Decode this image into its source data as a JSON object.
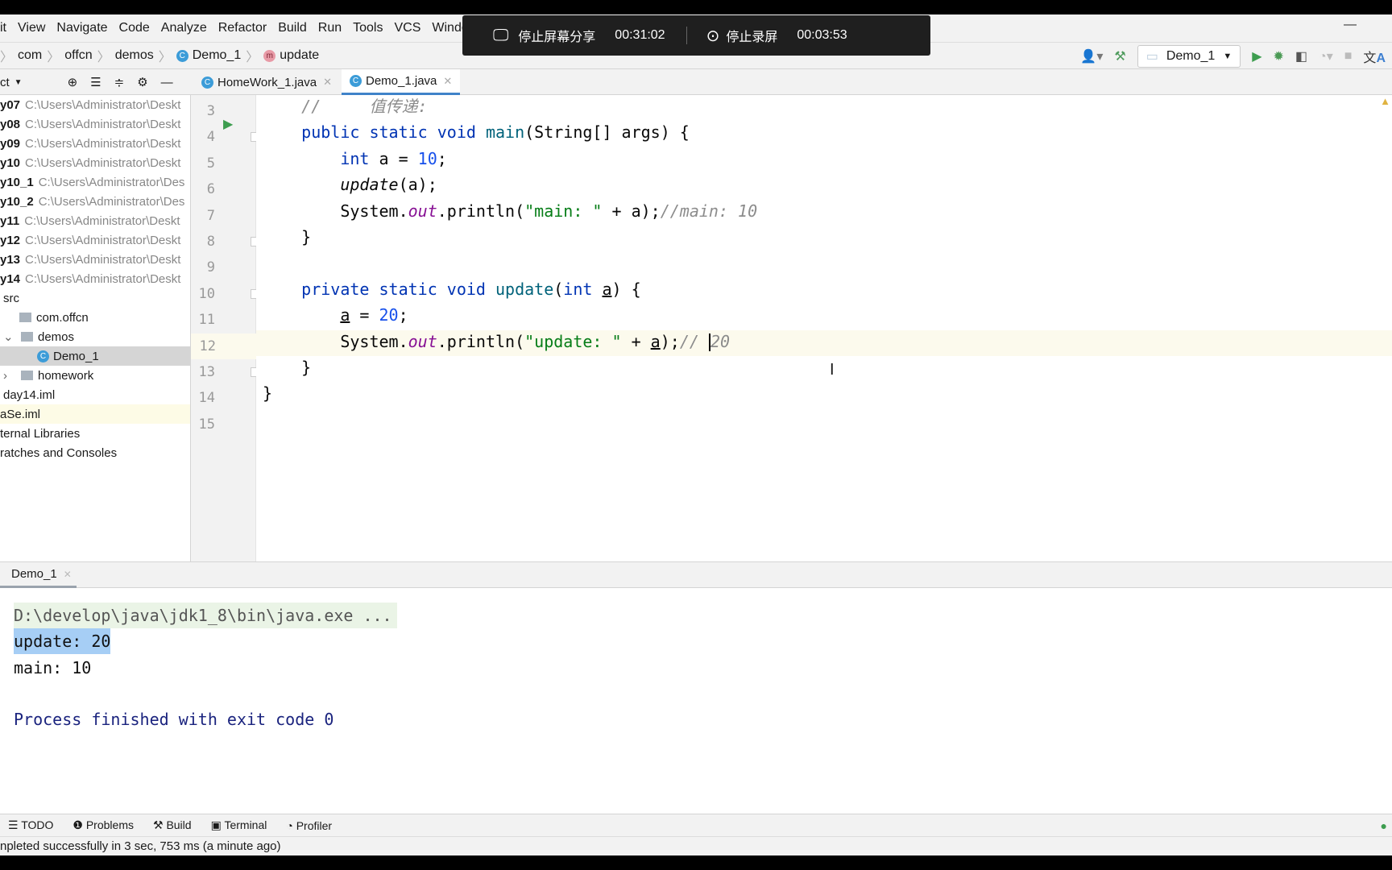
{
  "menu": [
    "it",
    "View",
    "Navigate",
    "Code",
    "Analyze",
    "Refactor",
    "Build",
    "Run",
    "Tools",
    "VCS",
    "Windo"
  ],
  "breadcrumb": [
    "com",
    "offcn",
    "demos",
    "Demo_1",
    "update"
  ],
  "toolbar": {
    "run_config": "Demo_1"
  },
  "project_header": "ct",
  "tabs": [
    {
      "label": "HomeWork_1.java"
    },
    {
      "label": "Demo_1.java"
    }
  ],
  "tree": [
    {
      "name": "y07",
      "path": "C:\\Users\\Administrator\\Deskt"
    },
    {
      "name": "y08",
      "path": "C:\\Users\\Administrator\\Deskt"
    },
    {
      "name": "y09",
      "path": "C:\\Users\\Administrator\\Deskt"
    },
    {
      "name": "y10",
      "path": "C:\\Users\\Administrator\\Deskt"
    },
    {
      "name": "y10_1",
      "path": "C:\\Users\\Administrator\\Des"
    },
    {
      "name": "y10_2",
      "path": "C:\\Users\\Administrator\\Des"
    },
    {
      "name": "y11",
      "path": "C:\\Users\\Administrator\\Deskt"
    },
    {
      "name": "y12",
      "path": "C:\\Users\\Administrator\\Deskt"
    },
    {
      "name": "y13",
      "path": "C:\\Users\\Administrator\\Deskt"
    },
    {
      "name": "y14",
      "path": "C:\\Users\\Administrator\\Deskt"
    }
  ],
  "tree_more": [
    "src",
    "com.offcn",
    "demos",
    "Demo_1",
    "homework",
    "day14.iml",
    "aSe.iml",
    "ternal Libraries",
    "ratches and Consoles"
  ],
  "line_numbers": [
    "3",
    "4",
    "5",
    "6",
    "7",
    "8",
    "9",
    "10",
    "11",
    "12",
    "13",
    "14",
    "15"
  ],
  "code": [
    [
      {
        "t": "    ",
        "c": ""
      },
      {
        "t": "//     值传递:",
        "c": "cm"
      }
    ],
    [
      {
        "t": "    ",
        "c": ""
      },
      {
        "t": "public static void ",
        "c": "kw"
      },
      {
        "t": "main",
        "c": "mth"
      },
      {
        "t": "(String[] args) {",
        "c": ""
      }
    ],
    [
      {
        "t": "        ",
        "c": ""
      },
      {
        "t": "int",
        "c": "kw"
      },
      {
        "t": " a = ",
        "c": ""
      },
      {
        "t": "10",
        "c": "num"
      },
      {
        "t": ";",
        "c": ""
      }
    ],
    [
      {
        "t": "        ",
        "c": ""
      },
      {
        "t": "update",
        "c": "it"
      },
      {
        "t": "(a);",
        "c": ""
      }
    ],
    [
      {
        "t": "        System.",
        "c": ""
      },
      {
        "t": "out",
        "c": "fld"
      },
      {
        "t": ".println(",
        "c": ""
      },
      {
        "t": "\"main: \"",
        "c": "str"
      },
      {
        "t": " + a);",
        "c": ""
      },
      {
        "t": "//main: 10",
        "c": "cm"
      }
    ],
    [
      {
        "t": "    }",
        "c": ""
      }
    ],
    [
      {
        "t": "",
        "c": ""
      }
    ],
    [
      {
        "t": "    ",
        "c": ""
      },
      {
        "t": "private static void ",
        "c": "kw"
      },
      {
        "t": "update",
        "c": "mth"
      },
      {
        "t": "(",
        "c": ""
      },
      {
        "t": "int ",
        "c": "kw"
      },
      {
        "t": "a",
        "c": "ul"
      },
      {
        "t": ") {",
        "c": ""
      }
    ],
    [
      {
        "t": "        ",
        "c": ""
      },
      {
        "t": "a",
        "c": "ul"
      },
      {
        "t": " = ",
        "c": ""
      },
      {
        "t": "20",
        "c": "num"
      },
      {
        "t": ";",
        "c": ""
      }
    ],
    [
      {
        "t": "        System.",
        "c": ""
      },
      {
        "t": "out",
        "c": "fld"
      },
      {
        "t": ".println(",
        "c": ""
      },
      {
        "t": "\"update: \"",
        "c": "str"
      },
      {
        "t": " + ",
        "c": ""
      },
      {
        "t": "a",
        "c": "ul"
      },
      {
        "t": ");",
        "c": ""
      },
      {
        "t": "// ",
        "c": "cm"
      },
      {
        "t": "|",
        "c": "caret"
      },
      {
        "t": "20",
        "c": "cm"
      }
    ],
    [
      {
        "t": "    }",
        "c": ""
      }
    ],
    [
      {
        "t": "}",
        "c": ""
      }
    ],
    [
      {
        "t": "",
        "c": ""
      }
    ]
  ],
  "run_tab": "Demo_1",
  "console": {
    "cmd": "D:\\develop\\java\\jdk1_8\\bin\\java.exe ...",
    "out1": "update: 20",
    "out2": "main: 10",
    "exit": "Process finished with exit code 0"
  },
  "tool_windows": [
    "TODO",
    "Problems",
    "Build",
    "Terminal",
    "Profiler"
  ],
  "status": "npleted successfully in 3 sec, 753 ms (a minute ago)",
  "recording": {
    "stop_share": "停止屏幕分享",
    "share_time": "00:31:02",
    "stop_record": "停止录屏",
    "record_time": "00:03:53"
  }
}
